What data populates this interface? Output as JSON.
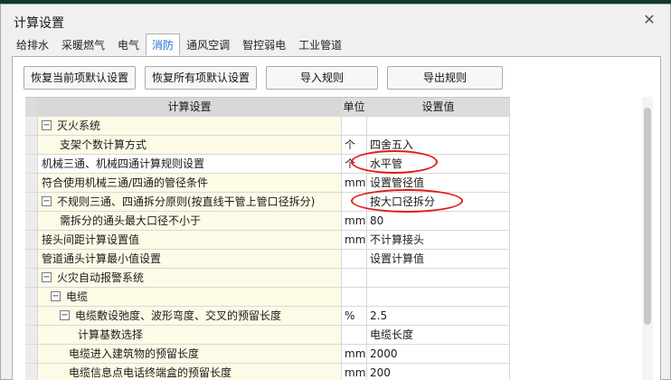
{
  "title": "计算设置",
  "tabs": [
    "给排水",
    "采暖燃气",
    "电气",
    "消防",
    "通风空调",
    "智控弱电",
    "工业管道"
  ],
  "active_tab": 3,
  "buttons": {
    "restore_current": "恢复当前项默认设置",
    "restore_all": "恢复所有项默认设置",
    "import": "导入规则",
    "export": "导出规则"
  },
  "columns": {
    "setting": "计算设置",
    "unit": "单位",
    "value": "设置值"
  },
  "rows": [
    {
      "label": "灭火系统",
      "unit": "",
      "value": "",
      "toggle": "−",
      "indent": 0
    },
    {
      "label": "支架个数计算方式",
      "unit": "个",
      "value": "四舍五入",
      "toggle": "",
      "indent": 2
    },
    {
      "label": "机械三通、机械四通计算规则设置",
      "unit": "个",
      "value": "水平管",
      "toggle": "",
      "indent": 0,
      "selected": true
    },
    {
      "label": "符合使用机械三通/四通的管径条件",
      "unit": "mm",
      "value": "设置管径值",
      "toggle": "",
      "indent": 0
    },
    {
      "label": "不规则三通、四通拆分原则(按直线干管上管口径拆分)",
      "unit": "",
      "value": "按大口径拆分",
      "toggle": "−",
      "indent": 0
    },
    {
      "label": "需拆分的通头最大口径不小于",
      "unit": "mm",
      "value": "80",
      "toggle": "",
      "indent": 2
    },
    {
      "label": "接头间距计算设置值",
      "unit": "mm",
      "value": "不计算接头",
      "toggle": "",
      "indent": 0
    },
    {
      "label": "管道通头计算最小值设置",
      "unit": "",
      "value": "设置计算值",
      "toggle": "",
      "indent": 0
    },
    {
      "label": "火灾自动报警系统",
      "unit": "",
      "value": "",
      "toggle": "−",
      "indent": 0
    },
    {
      "label": "电缆",
      "unit": "",
      "value": "",
      "toggle": "−",
      "indent": 1
    },
    {
      "label": "电缆敷设弛度、波形弯度、交叉的预留长度",
      "unit": "%",
      "value": "2.5",
      "toggle": "−",
      "indent": 2
    },
    {
      "label": "计算基数选择",
      "unit": "",
      "value": "电缆长度",
      "toggle": "",
      "indent": 4
    },
    {
      "label": "电缆进入建筑物的预留长度",
      "unit": "mm",
      "value": "2000",
      "toggle": "",
      "indent": 3
    },
    {
      "label": "电缆信息点电话终端盒的预留长度",
      "unit": "mm",
      "value": "200",
      "toggle": "",
      "indent": 3
    }
  ],
  "colors": {
    "accent_tab": "#1c6fd6",
    "highlight_ring": "#e21b1b",
    "label_bg": "#fdfbe6"
  }
}
